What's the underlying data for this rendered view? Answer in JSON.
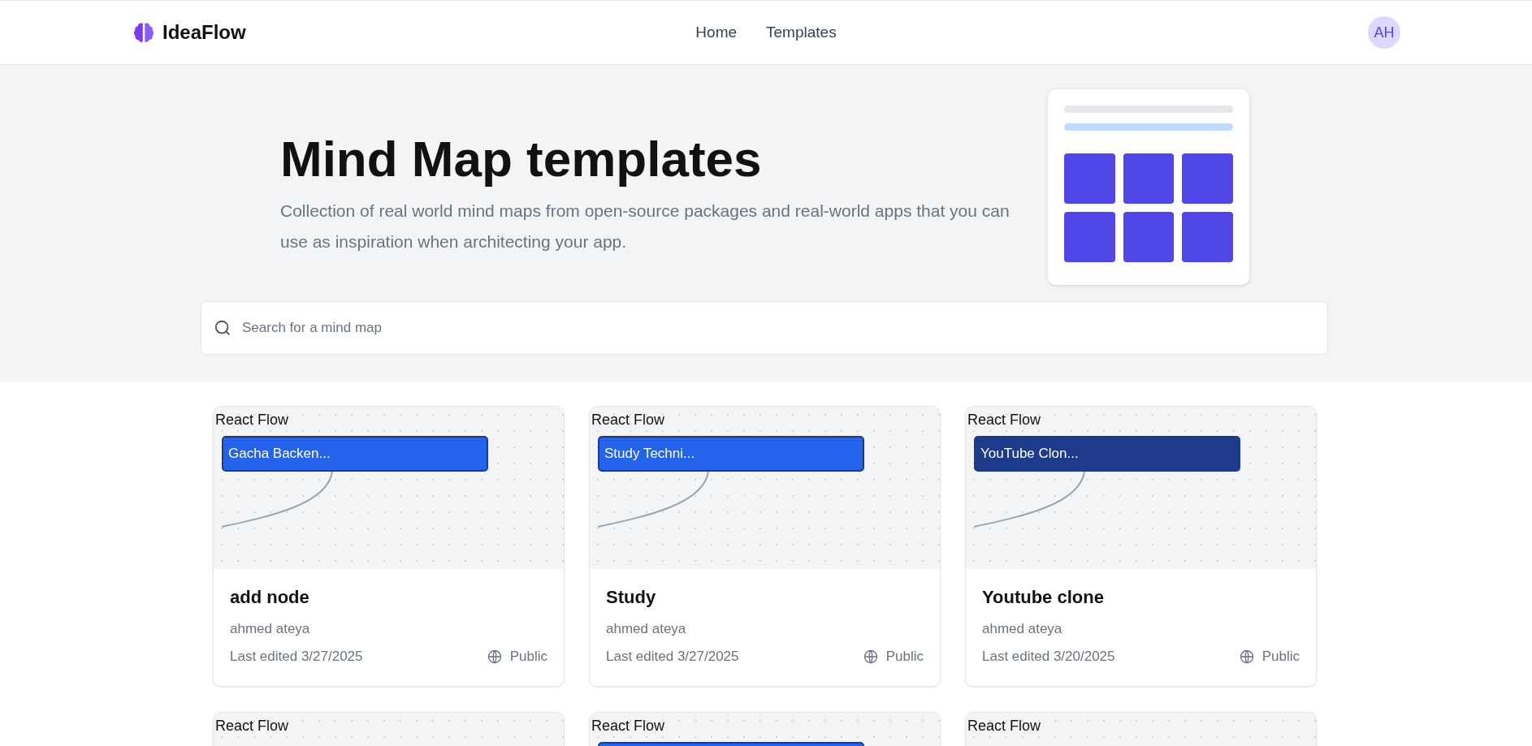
{
  "header": {
    "brand": "IdeaFlow",
    "nav": [
      {
        "label": "Home"
      },
      {
        "label": "Templates"
      }
    ],
    "avatar": "AH"
  },
  "hero": {
    "title": "Mind Map templates",
    "subtitle": "Collection of real world mind maps from open-source packages and real-world apps that you can use as inspiration when architecting your app."
  },
  "search": {
    "placeholder": "Search for a mind map"
  },
  "cards": [
    {
      "attribution": "React Flow",
      "node": {
        "label": "Gacha Backen...",
        "color": "#2563eb"
      },
      "title": "add node",
      "author": "ahmed ateya",
      "edited": "Last edited 3/27/2025",
      "visibility": "Public"
    },
    {
      "attribution": "React Flow",
      "node": {
        "label": "Study Techni...",
        "color": "#2563eb"
      },
      "title": "Study",
      "author": "ahmed ateya",
      "edited": "Last edited 3/27/2025",
      "visibility": "Public"
    },
    {
      "attribution": "React Flow",
      "node": {
        "label": "YouTube Clon...",
        "color": "#1e3a8a"
      },
      "title": "Youtube clone",
      "author": "ahmed ateya",
      "edited": "Last edited 3/20/2025",
      "visibility": "Public"
    },
    {
      "attribution": "React Flow"
    },
    {
      "attribution": "React Flow",
      "node": {
        "color": "#2563eb"
      }
    },
    {
      "attribution": "React Flow"
    }
  ]
}
